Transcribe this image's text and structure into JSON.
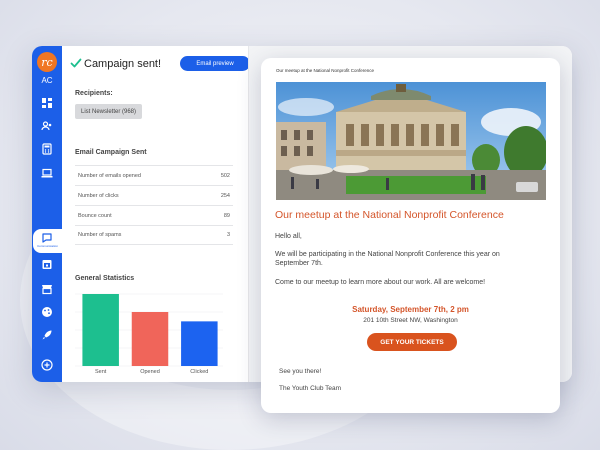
{
  "sidebar": {
    "logo_letter": "rc",
    "user_initials": "AC",
    "active_item_label": "Communication",
    "items": [
      {
        "icon": "dashboard-icon"
      },
      {
        "icon": "contacts-icon"
      },
      {
        "icon": "calculator-icon"
      },
      {
        "icon": "laptop-icon"
      },
      {
        "icon": "chat-icon"
      },
      {
        "icon": "calendar-icon"
      },
      {
        "icon": "store-icon"
      },
      {
        "icon": "palette-icon"
      },
      {
        "icon": "rocket-icon"
      },
      {
        "icon": "add-icon"
      }
    ]
  },
  "header": {
    "title": "Campaign sent!",
    "preview_button": "Email preview"
  },
  "recipients": {
    "label": "Recipients:",
    "list": "List Newsletter (968)"
  },
  "campaign_stats": {
    "title": "Email Campaign Sent",
    "rows": [
      {
        "label": "Number of emails opened",
        "value": "502"
      },
      {
        "label": "Number of clicks",
        "value": "254"
      },
      {
        "label": "Bounce count",
        "value": "89"
      },
      {
        "label": "Number of spams",
        "value": "3"
      }
    ]
  },
  "general_stats": {
    "title": "General Statistics"
  },
  "chart_data": {
    "type": "bar",
    "categories": [
      "Sent",
      "Opened",
      "Clicked"
    ],
    "values": [
      100,
      75,
      62
    ],
    "colors": [
      "#1dbf8f",
      "#f0655a",
      "#1c63f0"
    ],
    "ylim": [
      0,
      100
    ],
    "grid": true
  },
  "email": {
    "header": "Our meetup at the National Nonprofit Conference",
    "title": "Our meetup at the National Nonprofit Conference",
    "greeting": "Hello all,",
    "para1": "We will be participating in the National Nonprofit Conference this year on September 7th.",
    "para2": "Come to our meetup to learn more about our work. All are welcome!",
    "event_date": "Saturday, September 7th, 2 pm",
    "event_address": "201 10th Street NW, Washington",
    "cta": "GET YOUR TICKETS",
    "signoff": "See you there!",
    "team": "The Youth Club Team"
  },
  "colors": {
    "brand": "#1c5fe8",
    "accent": "#d4552a",
    "logo": "#f07623"
  }
}
